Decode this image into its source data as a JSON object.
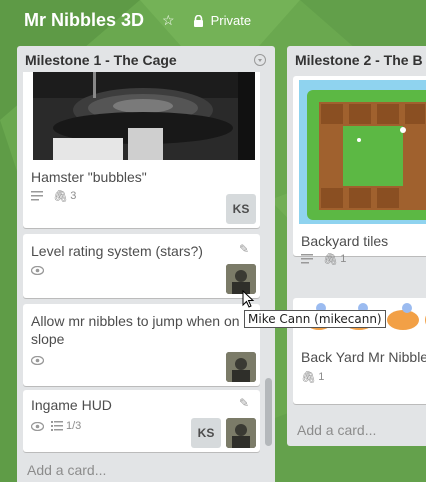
{
  "board": {
    "title": "Mr Nibbles 3D",
    "star_icon": "star-icon",
    "visibility": "Private",
    "visibility_icon": "lock-icon"
  },
  "colors": {
    "board_bg": "#6aa84f",
    "list_bg": "#e2e4e6",
    "card_bg": "#ffffff"
  },
  "lists": [
    {
      "title": "Milestone 1 - The Cage",
      "cards": [
        {
          "title": "Hamster \"bubbles\"",
          "has_description": true,
          "attachments": "3",
          "members": [
            "KS"
          ]
        },
        {
          "title": "Level rating system (stars?)",
          "subscribed": true,
          "members": [
            "avatar"
          ]
        },
        {
          "title": "Allow mr nibbles to jump when on slope",
          "subscribed": true,
          "members": [
            "avatar"
          ]
        },
        {
          "title": "Ingame HUD",
          "subscribed": true,
          "checklist": "1/3",
          "members": [
            "KS",
            "avatar"
          ]
        }
      ],
      "add_card": "Add a card..."
    },
    {
      "title": "Milestone 2 - The B",
      "cards": [
        {
          "title": "Backyard tiles",
          "has_description": true,
          "attachments": "1"
        },
        {
          "title": "Back Yard Mr Nibble",
          "attachments": "1"
        }
      ],
      "add_card": "Add a card..."
    }
  ],
  "members": {
    "ks_initials": "KS"
  },
  "tooltip": "Mike Cann (mikecann)"
}
